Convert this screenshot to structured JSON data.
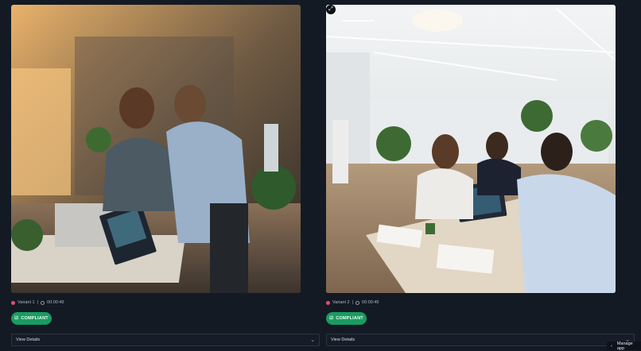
{
  "variants": [
    {
      "label": "Variant 1",
      "time": "00:00:49",
      "badge": "COMPLIANT",
      "details_label": "View Details"
    },
    {
      "label": "Variant 2",
      "time": "00:00:45",
      "badge": "COMPLIANT",
      "details_label": "View Details"
    }
  ],
  "footer": {
    "manage_label": "Manage app"
  },
  "colors": {
    "accent": "#1a9b61",
    "background": "#141a24",
    "variant_dot": "#e04f6c"
  },
  "icons": {
    "expand": "expand-icon",
    "badge": "check-badge-icon",
    "chevron": "chevron-down-icon",
    "back": "chevron-left-icon"
  }
}
